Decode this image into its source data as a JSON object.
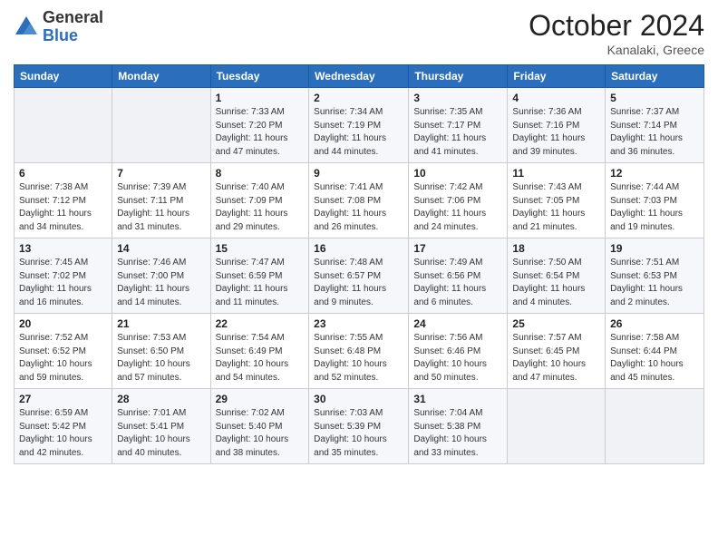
{
  "header": {
    "logo_general": "General",
    "logo_blue": "Blue",
    "month": "October 2024",
    "location": "Kanalaki, Greece"
  },
  "days_of_week": [
    "Sunday",
    "Monday",
    "Tuesday",
    "Wednesday",
    "Thursday",
    "Friday",
    "Saturday"
  ],
  "weeks": [
    [
      {
        "day": "",
        "info": ""
      },
      {
        "day": "",
        "info": ""
      },
      {
        "day": "1",
        "info": "Sunrise: 7:33 AM\nSunset: 7:20 PM\nDaylight: 11 hours and 47 minutes."
      },
      {
        "day": "2",
        "info": "Sunrise: 7:34 AM\nSunset: 7:19 PM\nDaylight: 11 hours and 44 minutes."
      },
      {
        "day": "3",
        "info": "Sunrise: 7:35 AM\nSunset: 7:17 PM\nDaylight: 11 hours and 41 minutes."
      },
      {
        "day": "4",
        "info": "Sunrise: 7:36 AM\nSunset: 7:16 PM\nDaylight: 11 hours and 39 minutes."
      },
      {
        "day": "5",
        "info": "Sunrise: 7:37 AM\nSunset: 7:14 PM\nDaylight: 11 hours and 36 minutes."
      }
    ],
    [
      {
        "day": "6",
        "info": "Sunrise: 7:38 AM\nSunset: 7:12 PM\nDaylight: 11 hours and 34 minutes."
      },
      {
        "day": "7",
        "info": "Sunrise: 7:39 AM\nSunset: 7:11 PM\nDaylight: 11 hours and 31 minutes."
      },
      {
        "day": "8",
        "info": "Sunrise: 7:40 AM\nSunset: 7:09 PM\nDaylight: 11 hours and 29 minutes."
      },
      {
        "day": "9",
        "info": "Sunrise: 7:41 AM\nSunset: 7:08 PM\nDaylight: 11 hours and 26 minutes."
      },
      {
        "day": "10",
        "info": "Sunrise: 7:42 AM\nSunset: 7:06 PM\nDaylight: 11 hours and 24 minutes."
      },
      {
        "day": "11",
        "info": "Sunrise: 7:43 AM\nSunset: 7:05 PM\nDaylight: 11 hours and 21 minutes."
      },
      {
        "day": "12",
        "info": "Sunrise: 7:44 AM\nSunset: 7:03 PM\nDaylight: 11 hours and 19 minutes."
      }
    ],
    [
      {
        "day": "13",
        "info": "Sunrise: 7:45 AM\nSunset: 7:02 PM\nDaylight: 11 hours and 16 minutes."
      },
      {
        "day": "14",
        "info": "Sunrise: 7:46 AM\nSunset: 7:00 PM\nDaylight: 11 hours and 14 minutes."
      },
      {
        "day": "15",
        "info": "Sunrise: 7:47 AM\nSunset: 6:59 PM\nDaylight: 11 hours and 11 minutes."
      },
      {
        "day": "16",
        "info": "Sunrise: 7:48 AM\nSunset: 6:57 PM\nDaylight: 11 hours and 9 minutes."
      },
      {
        "day": "17",
        "info": "Sunrise: 7:49 AM\nSunset: 6:56 PM\nDaylight: 11 hours and 6 minutes."
      },
      {
        "day": "18",
        "info": "Sunrise: 7:50 AM\nSunset: 6:54 PM\nDaylight: 11 hours and 4 minutes."
      },
      {
        "day": "19",
        "info": "Sunrise: 7:51 AM\nSunset: 6:53 PM\nDaylight: 11 hours and 2 minutes."
      }
    ],
    [
      {
        "day": "20",
        "info": "Sunrise: 7:52 AM\nSunset: 6:52 PM\nDaylight: 10 hours and 59 minutes."
      },
      {
        "day": "21",
        "info": "Sunrise: 7:53 AM\nSunset: 6:50 PM\nDaylight: 10 hours and 57 minutes."
      },
      {
        "day": "22",
        "info": "Sunrise: 7:54 AM\nSunset: 6:49 PM\nDaylight: 10 hours and 54 minutes."
      },
      {
        "day": "23",
        "info": "Sunrise: 7:55 AM\nSunset: 6:48 PM\nDaylight: 10 hours and 52 minutes."
      },
      {
        "day": "24",
        "info": "Sunrise: 7:56 AM\nSunset: 6:46 PM\nDaylight: 10 hours and 50 minutes."
      },
      {
        "day": "25",
        "info": "Sunrise: 7:57 AM\nSunset: 6:45 PM\nDaylight: 10 hours and 47 minutes."
      },
      {
        "day": "26",
        "info": "Sunrise: 7:58 AM\nSunset: 6:44 PM\nDaylight: 10 hours and 45 minutes."
      }
    ],
    [
      {
        "day": "27",
        "info": "Sunrise: 6:59 AM\nSunset: 5:42 PM\nDaylight: 10 hours and 42 minutes."
      },
      {
        "day": "28",
        "info": "Sunrise: 7:01 AM\nSunset: 5:41 PM\nDaylight: 10 hours and 40 minutes."
      },
      {
        "day": "29",
        "info": "Sunrise: 7:02 AM\nSunset: 5:40 PM\nDaylight: 10 hours and 38 minutes."
      },
      {
        "day": "30",
        "info": "Sunrise: 7:03 AM\nSunset: 5:39 PM\nDaylight: 10 hours and 35 minutes."
      },
      {
        "day": "31",
        "info": "Sunrise: 7:04 AM\nSunset: 5:38 PM\nDaylight: 10 hours and 33 minutes."
      },
      {
        "day": "",
        "info": ""
      },
      {
        "day": "",
        "info": ""
      }
    ]
  ]
}
